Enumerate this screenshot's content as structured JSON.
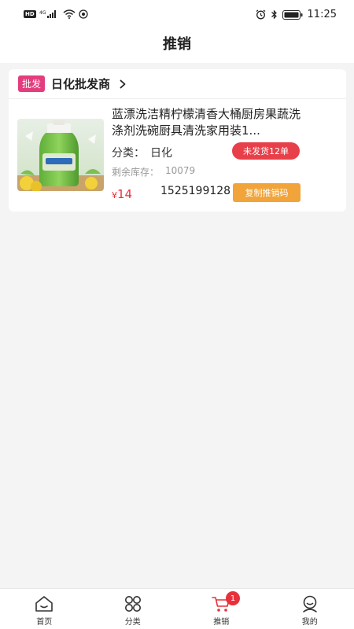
{
  "status_bar": {
    "hd_label": "HD",
    "time": "11:25"
  },
  "header": {
    "title": "推销"
  },
  "shop": {
    "tag": "批发",
    "name": "日化批发商"
  },
  "product": {
    "title": "蓝漂洗洁精柠檬清香大桶厨房果蔬洗涤剂洗碗厨具清洗家用装1...",
    "category_label": "分类：",
    "category_value": "日化",
    "unshipped_badge": "未发货12单",
    "stock_label": "剩余库存：",
    "stock_value": "10079",
    "price_symbol": "¥",
    "price": "14",
    "phone": "1525199128",
    "copy_button": "复制推销码"
  },
  "tabbar": {
    "tabs": [
      {
        "label": "首页",
        "icon": "home-icon"
      },
      {
        "label": "分类",
        "icon": "grid-icon"
      },
      {
        "label": "推销",
        "icon": "cart-icon",
        "badge": "1"
      },
      {
        "label": "我的",
        "icon": "profile-icon"
      }
    ]
  },
  "colors": {
    "accent_red": "#e8303a",
    "tag_pink": "#e43d7d",
    "copy_orange": "#f1a43a"
  }
}
